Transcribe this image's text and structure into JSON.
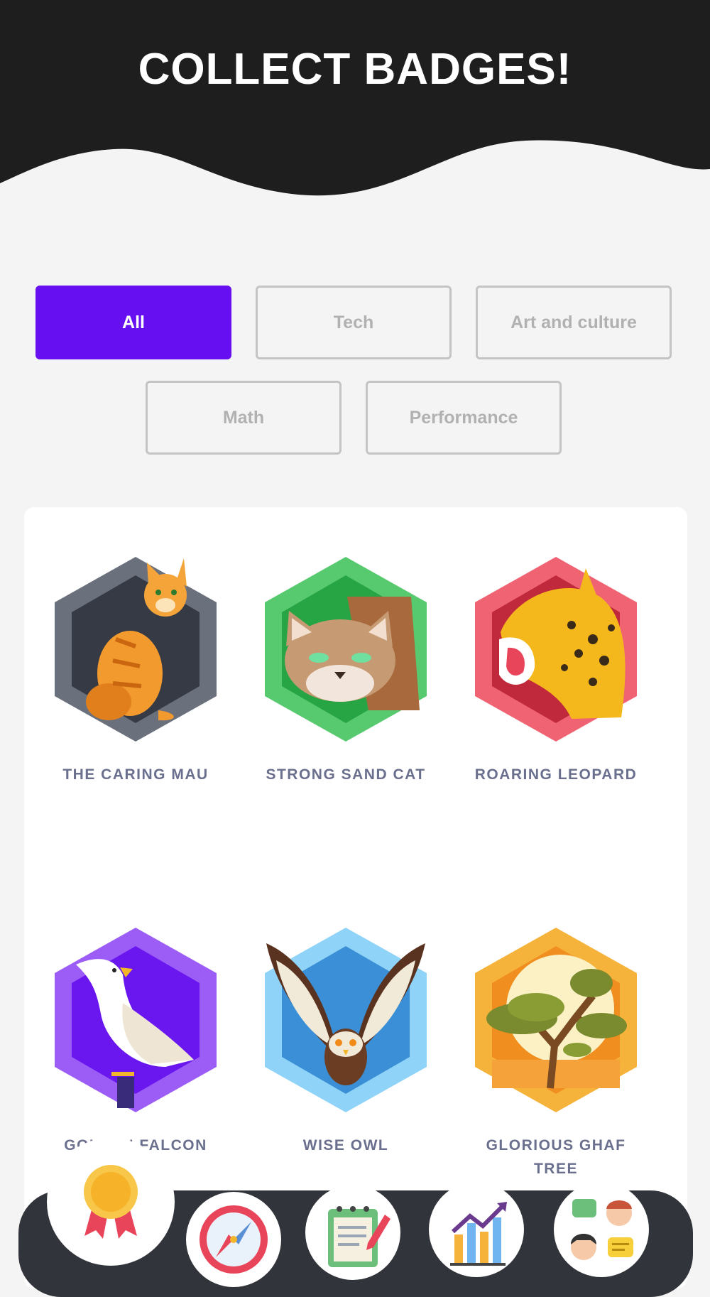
{
  "header": {
    "title": "COLLECT BADGES!",
    "background_color": "#1e1e1e"
  },
  "filters": {
    "active_color": "#6610f2",
    "items": [
      {
        "label": "All",
        "active": true
      },
      {
        "label": "Tech",
        "active": false
      },
      {
        "label": "Art and culture",
        "active": false
      },
      {
        "label": "Math",
        "active": false
      },
      {
        "label": "Performance",
        "active": false
      }
    ]
  },
  "badges": [
    {
      "label": "THE CARING MAU",
      "icon": "cat-icon",
      "color": "#555b66"
    },
    {
      "label": "STRONG SAND CAT",
      "icon": "sand-cat-icon",
      "color": "#4cc56a"
    },
    {
      "label": "ROARING LEOPARD",
      "icon": "leopard-icon",
      "color": "#e8455a"
    },
    {
      "label": "GOLDEN FALCON",
      "icon": "falcon-icon",
      "color": "#8e52f0"
    },
    {
      "label": "WISE OWL",
      "icon": "owl-icon",
      "color": "#6cc2f5"
    },
    {
      "label": "GLORIOUS GHAF TREE",
      "icon": "ghaf-tree-icon",
      "color": "#f0a52c"
    }
  ],
  "nav": {
    "items": [
      {
        "name": "badges",
        "icon": "ribbon-badge-icon",
        "active": true
      },
      {
        "name": "explore",
        "icon": "compass-icon",
        "active": false
      },
      {
        "name": "notes",
        "icon": "notepad-icon",
        "active": false
      },
      {
        "name": "progress",
        "icon": "bar-chart-icon",
        "active": false
      },
      {
        "name": "community",
        "icon": "chat-people-icon",
        "active": false
      }
    ]
  }
}
